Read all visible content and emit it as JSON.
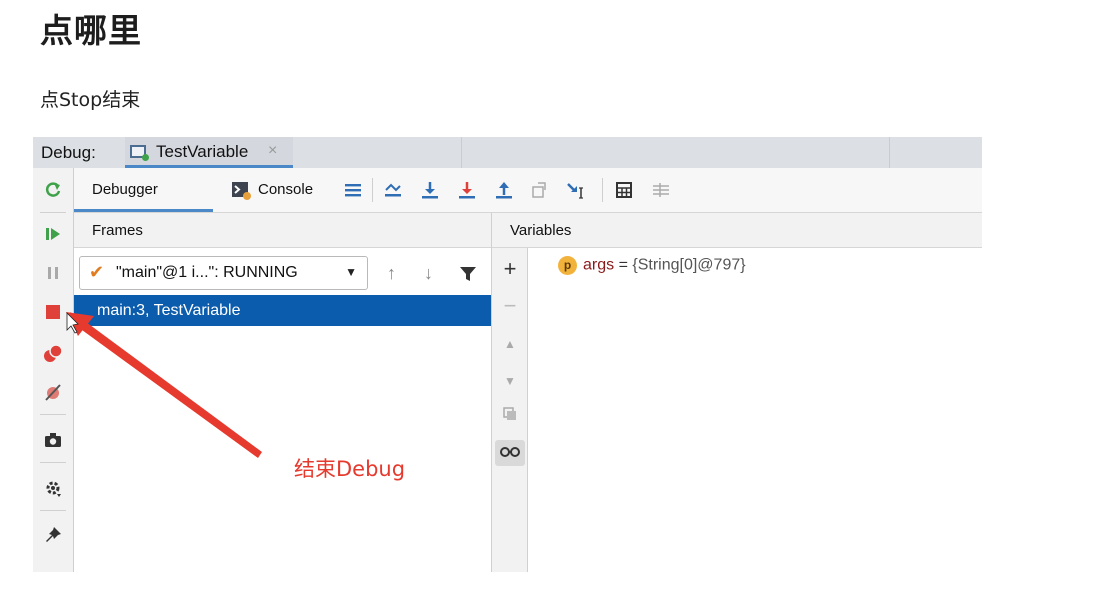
{
  "doc": {
    "title": "点哪里",
    "text": "点Stop结束"
  },
  "ide": {
    "debug_label": "Debug:",
    "run_tab": "TestVariable",
    "close_glyph": "×",
    "toolbar": {
      "debugger_tab": "Debugger",
      "console_tab": "Console"
    },
    "frames": {
      "header": "Frames",
      "thread": "\"main\"@1 i...\": RUNNING",
      "selected_frame": "main:3, TestVariable"
    },
    "variables": {
      "header": "Variables",
      "badge": "p",
      "name": "args",
      "equals": "=",
      "value": "{String[0]@797}"
    },
    "colors": {
      "accent": "#4a88c7",
      "selection": "#0b5cad",
      "stop": "#e0403a",
      "resume": "#3fa24a",
      "annotation": "#e63a2e"
    }
  },
  "annotation": {
    "label": "结束Debug"
  }
}
